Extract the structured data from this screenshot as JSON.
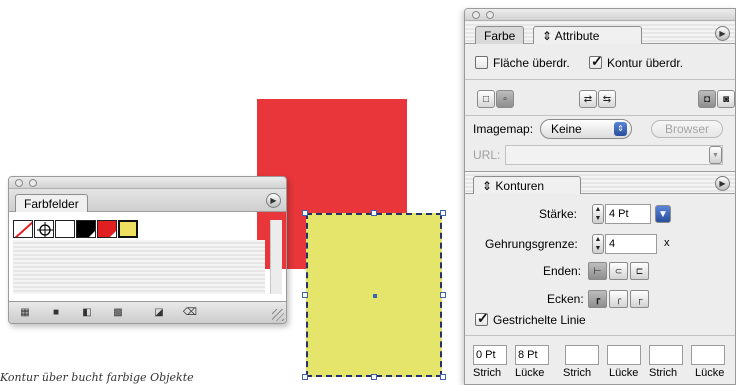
{
  "swatches_panel": {
    "tab_label": "Farbfelder",
    "swatch_colors": [
      "none",
      "registration",
      "#ffffff",
      "#000000",
      "#e02020",
      "#f0e060"
    ],
    "bottom_icons": [
      "swatch-view-icon",
      "new-color-icon",
      "new-gradient-icon",
      "new-pattern-icon",
      "new-swatch-icon",
      "trash-icon"
    ]
  },
  "attribute_panel": {
    "tab_inactive": "Farbe",
    "tab_active": "Attribute",
    "fill_overprint": {
      "label": "Fläche überdr.",
      "checked": false
    },
    "stroke_overprint": {
      "label": "Kontur überdr.",
      "checked": true
    },
    "imagemap": {
      "label": "Imagemap:",
      "value": "Keine",
      "browser_label": "Browser"
    },
    "url_label": "URL:"
  },
  "stroke_panel": {
    "tab_label": "Konturen",
    "weight_label": "Stärke:",
    "weight_value": "4 Pt",
    "miter_label": "Gehrungsgrenze:",
    "miter_value": "4",
    "miter_unit": "x",
    "caps_label": "Enden:",
    "joins_label": "Ecken:",
    "dashed": {
      "label": "Gestrichelte Linie",
      "checked": true
    },
    "dash_fields": [
      {
        "value": "0 Pt"
      },
      {
        "value": "8 Pt"
      },
      {
        "value": ""
      },
      {
        "value": ""
      },
      {
        "value": ""
      },
      {
        "value": ""
      }
    ],
    "dash_labels": [
      "Strich",
      "Lücke",
      "Strich",
      "Lücke",
      "Strich",
      "Lücke"
    ]
  },
  "canvas": {
    "red_color": "#e8363a",
    "yellow_color": "#e6e56b"
  },
  "caption": "Kontur über bucht farbige Objekte"
}
